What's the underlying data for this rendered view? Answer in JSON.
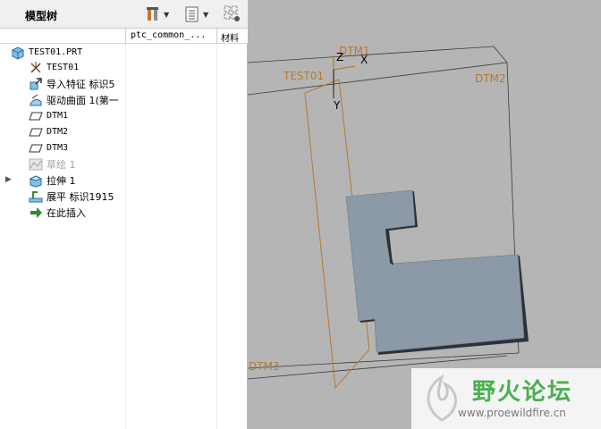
{
  "tree_panel": {
    "title": "模型树",
    "columns": {
      "col1": "ptc_common_...",
      "col2": "材料"
    },
    "items": [
      {
        "label": "TEST01.PRT",
        "icon": "part-icon"
      },
      {
        "label": "TEST01",
        "icon": "csys-icon"
      },
      {
        "label": "导入特征 标识5",
        "icon": "import-feature-icon"
      },
      {
        "label": "驱动曲面 1(第一",
        "icon": "driving-surface-icon"
      },
      {
        "label": "DTM1",
        "icon": "datum-plane-icon"
      },
      {
        "label": "DTM2",
        "icon": "datum-plane-icon"
      },
      {
        "label": "DTM3",
        "icon": "datum-plane-icon"
      },
      {
        "label": "草绘 1",
        "icon": "sketch-icon"
      },
      {
        "label": "拉伸 1",
        "icon": "extrude-icon"
      },
      {
        "label": "展平 标识1915",
        "icon": "flatten-icon"
      },
      {
        "label": "在此插入",
        "icon": "insert-here-icon"
      }
    ]
  },
  "viewport": {
    "datum_labels": {
      "dtm1": "DTM1",
      "dtm2": "DTM2",
      "dtm3": "DTM3",
      "csys": "TEST01"
    },
    "axis_labels": {
      "z": "Z",
      "x": "X",
      "y": "Y"
    },
    "colors": {
      "background": "#b5b5b5",
      "datum": "#b97a2c",
      "part": "#8b9aa6"
    }
  },
  "watermark": {
    "text": "野火论坛",
    "url": "www.proewildfire.cn"
  }
}
